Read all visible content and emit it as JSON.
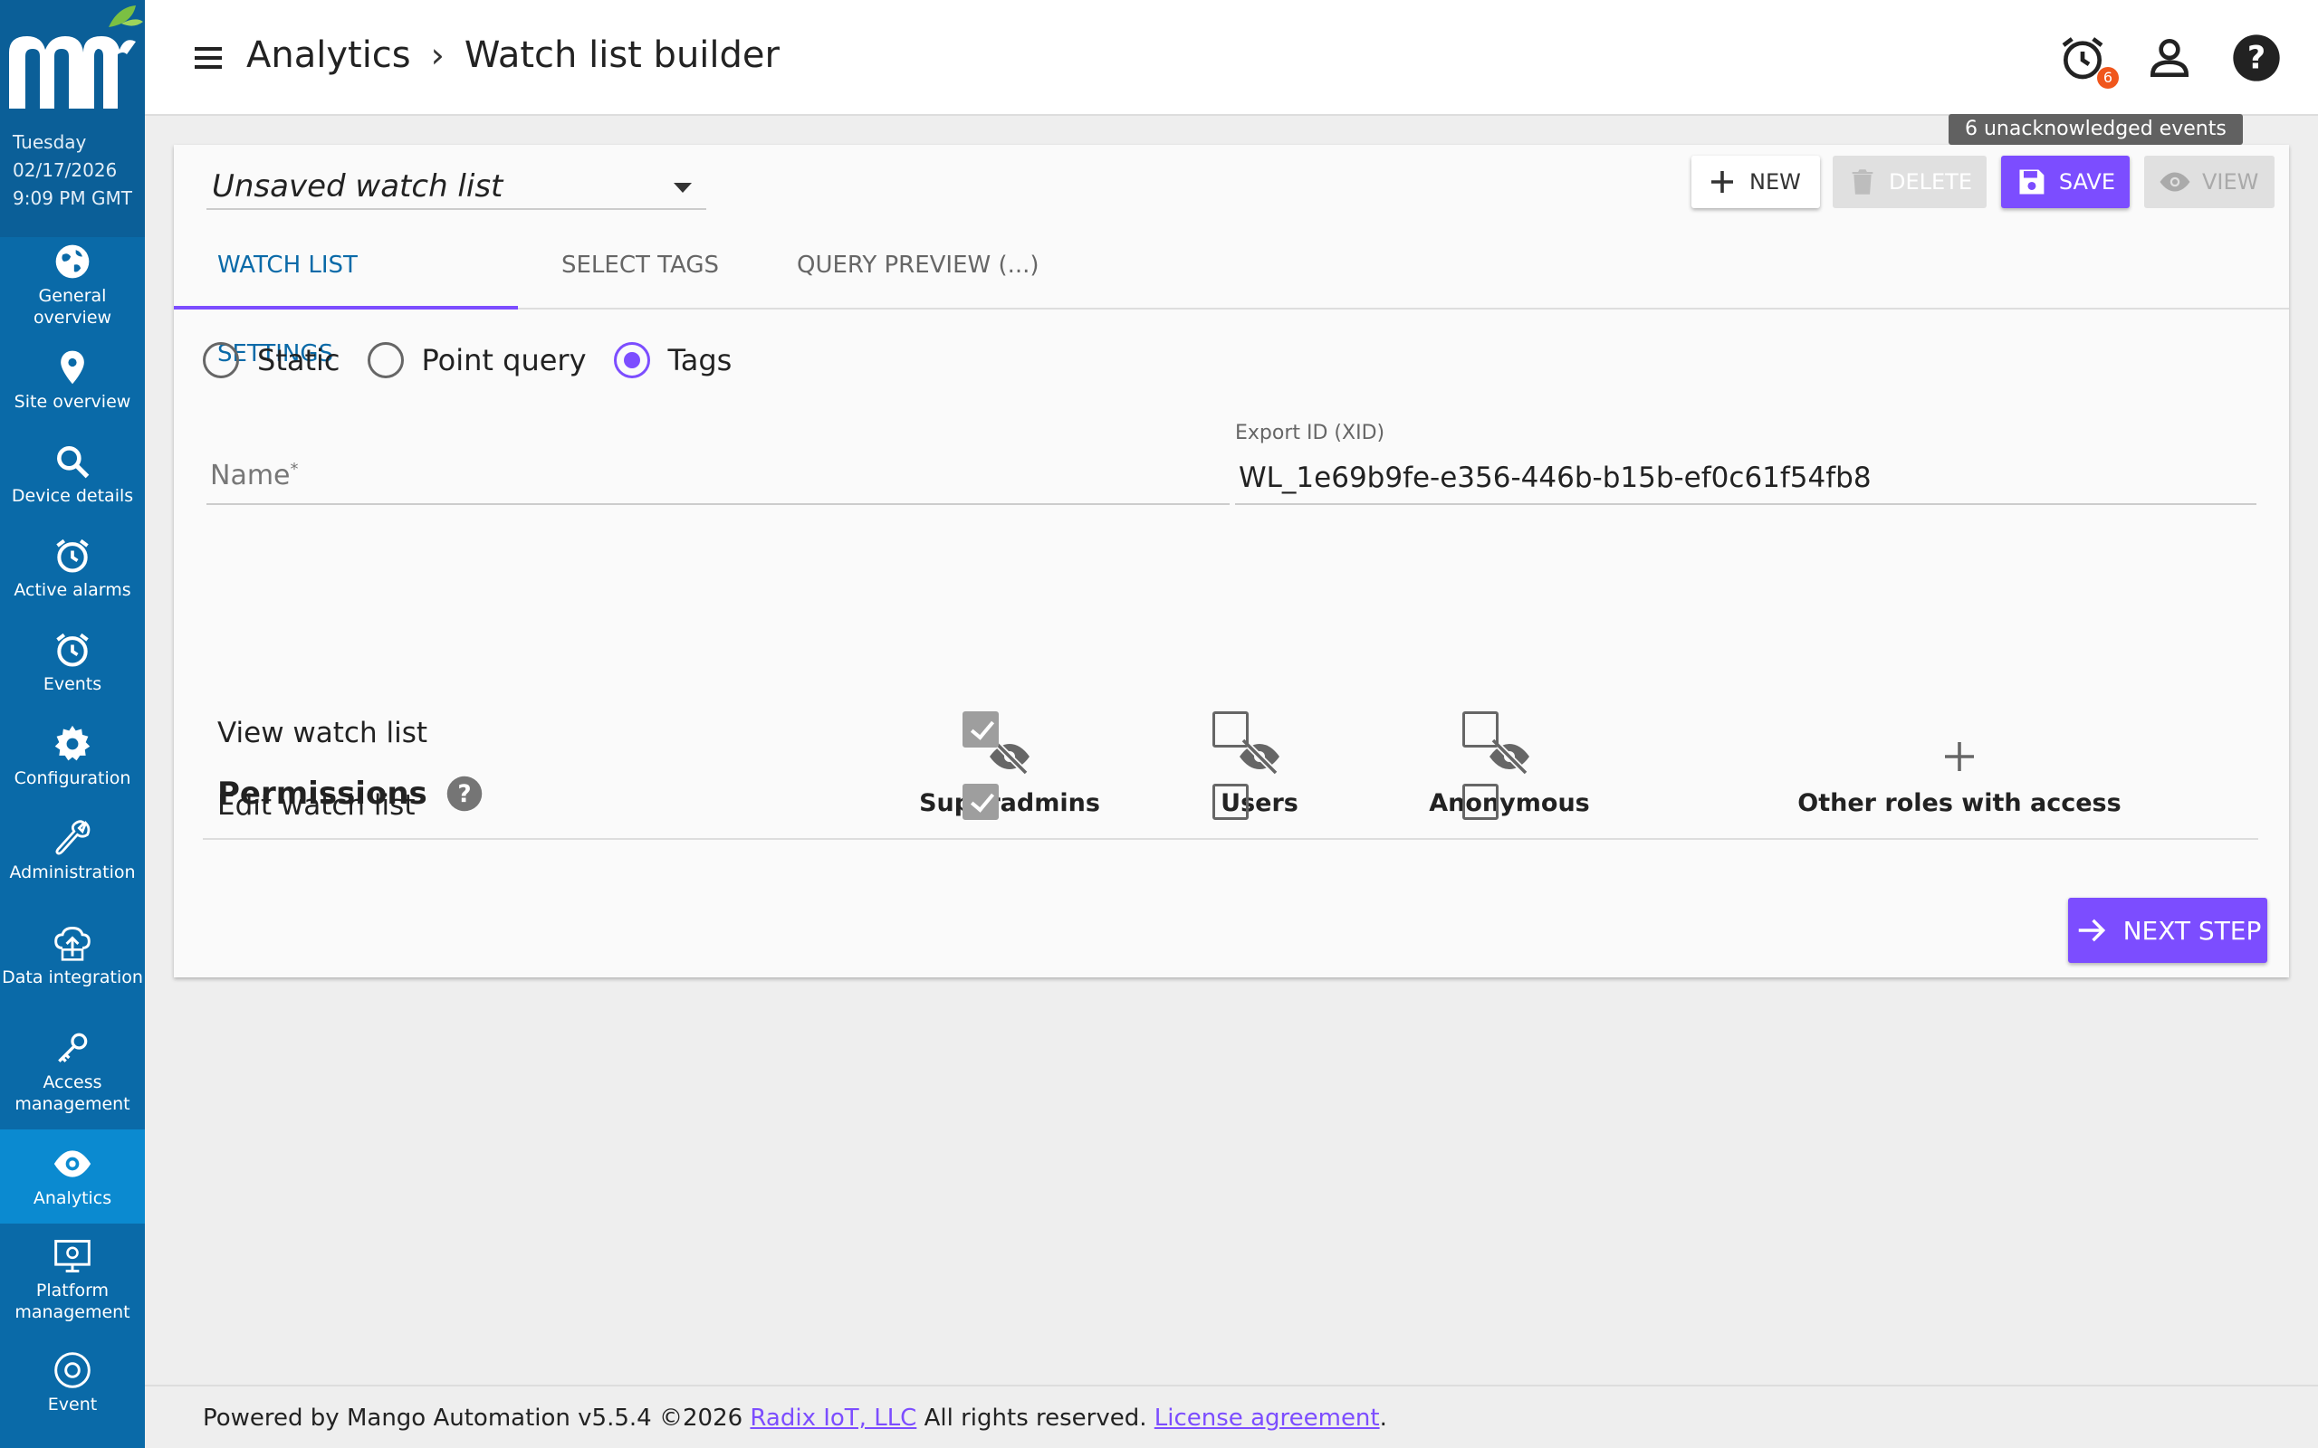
{
  "sidebar": {
    "date": {
      "day": "Tuesday",
      "date": "02/17/2026",
      "time": "9:09 PM GMT"
    },
    "items": [
      {
        "label": "General overview",
        "icon": "globe-icon"
      },
      {
        "label": "Site overview",
        "icon": "location-pin-icon"
      },
      {
        "label": "Device details",
        "icon": "search-icon"
      },
      {
        "label": "Active alarms",
        "icon": "alarm-clock-icon"
      },
      {
        "label": "Events",
        "icon": "alarm-clock-icon"
      },
      {
        "label": "Configuration",
        "icon": "gear-icon"
      },
      {
        "label": "Administration",
        "icon": "wrench-icon"
      },
      {
        "label": "Data integration",
        "icon": "cloud-upload-icon"
      },
      {
        "label": "Access management",
        "icon": "key-icon"
      },
      {
        "label": "Analytics",
        "icon": "eye-icon"
      },
      {
        "label": "Platform management",
        "icon": "monitor-icon"
      },
      {
        "label": "Event",
        "icon": "gear-ring-icon"
      }
    ]
  },
  "header": {
    "breadcrumb": [
      "Analytics",
      "Watch list builder"
    ],
    "alarm_count": "6",
    "tooltip": "6 unacknowledged events"
  },
  "card": {
    "watchlist_select": "Unsaved watch list",
    "buttons": {
      "new": "NEW",
      "delete": "DELETE",
      "save": "SAVE",
      "view": "VIEW"
    },
    "tabs": [
      "WATCH LIST SETTINGS",
      "SELECT TAGS",
      "QUERY PREVIEW (...)"
    ],
    "radios": [
      {
        "label": "Static",
        "checked": false
      },
      {
        "label": "Point query",
        "checked": false
      },
      {
        "label": "Tags",
        "checked": true
      }
    ],
    "name_placeholder": "Name",
    "xid_label": "Export ID (XID)",
    "xid_value": "WL_1e69b9fe-e356-446b-b15b-ef0c61f54fb8",
    "permissions": {
      "title": "Permissions",
      "columns": [
        "Superadmins",
        "Users",
        "Anonymous",
        "Other roles with access"
      ],
      "rows": [
        {
          "label": "View watch list",
          "values": [
            true,
            false,
            false
          ]
        },
        {
          "label": "Edit watch list",
          "values": [
            true,
            false,
            false
          ]
        }
      ]
    },
    "next_step": "NEXT STEP"
  },
  "footer": {
    "prefix": "Powered by Mango Automation v5.5.4 ©2026 ",
    "company": "Radix IoT, LLC",
    "middle": " All rights reserved. ",
    "license": "License agreement",
    "suffix": "."
  },
  "colors": {
    "sidebar": "#0a6aa8",
    "accent": "#7c4dff",
    "active_tab": "#0a6aa8",
    "badge": "#f0561c"
  }
}
